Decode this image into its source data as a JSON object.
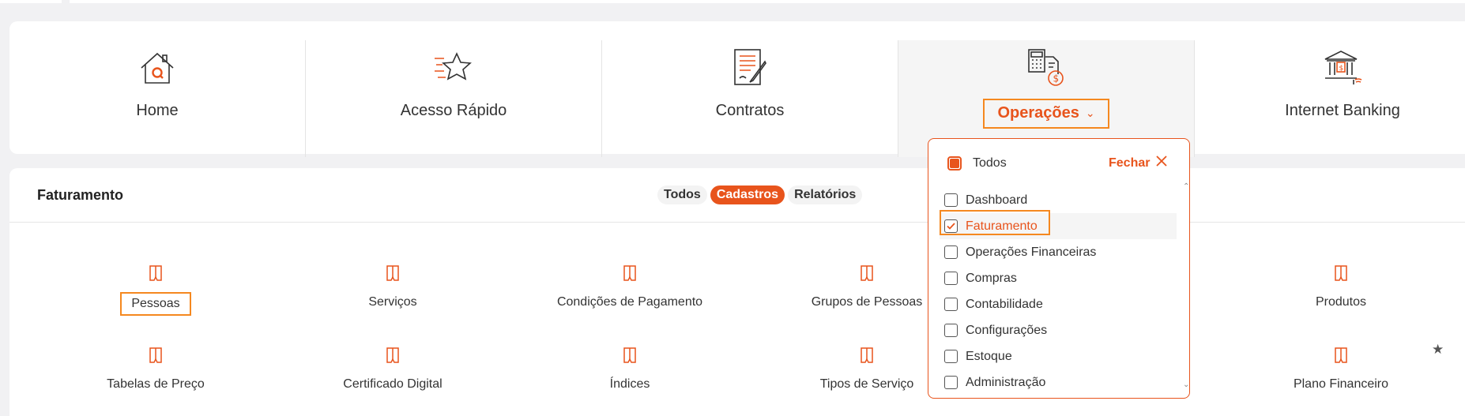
{
  "nav": {
    "items": [
      {
        "label": "Home",
        "icon": "home-icon"
      },
      {
        "label": "Acesso Rápido",
        "icon": "quick-access-star-icon"
      },
      {
        "label": "Contratos",
        "icon": "contract-document-icon"
      },
      {
        "label": "Operações",
        "icon": "calculator-money-icon"
      },
      {
        "label": "Internet Banking",
        "icon": "bank-icon"
      }
    ],
    "active_index": 3,
    "dropdown_chevron": "⌄"
  },
  "section": {
    "title": "Faturamento",
    "filters": [
      "Todos",
      "Cadastros",
      "Relatórios"
    ],
    "active_filter": "Cadastros"
  },
  "tiles": [
    {
      "label": "Pessoas",
      "icon": "document-icon"
    },
    {
      "label": "Serviços",
      "icon": "document-icon"
    },
    {
      "label": "Condições de Pagamento",
      "icon": "document-icon"
    },
    {
      "label": "Grupos de Pessoas",
      "icon": "document-icon"
    },
    {
      "label": "Produtos",
      "icon": "document-icon"
    },
    {
      "label": "Tabelas de Preço",
      "icon": "document-icon"
    },
    {
      "label": "Certificado Digital",
      "icon": "document-icon"
    },
    {
      "label": "Índices",
      "icon": "document-icon"
    },
    {
      "label": "Tipos de Serviço",
      "icon": "document-icon"
    },
    {
      "label": "Plano Financeiro",
      "icon": "document-icon"
    }
  ],
  "dropdown": {
    "all_label": "Todos",
    "close_label": "Fechar",
    "options": [
      {
        "label": "Dashboard",
        "checked": false
      },
      {
        "label": "Faturamento",
        "checked": true
      },
      {
        "label": "Operações Financeiras",
        "checked": false
      },
      {
        "label": "Compras",
        "checked": false
      },
      {
        "label": "Contabilidade",
        "checked": false
      },
      {
        "label": "Configurações",
        "checked": false
      },
      {
        "label": "Estoque",
        "checked": false
      },
      {
        "label": "Administração",
        "checked": false
      }
    ]
  },
  "favorite_icon": "star-icon",
  "colors": {
    "accent": "#e8541c",
    "highlight_border": "#f5881f"
  }
}
